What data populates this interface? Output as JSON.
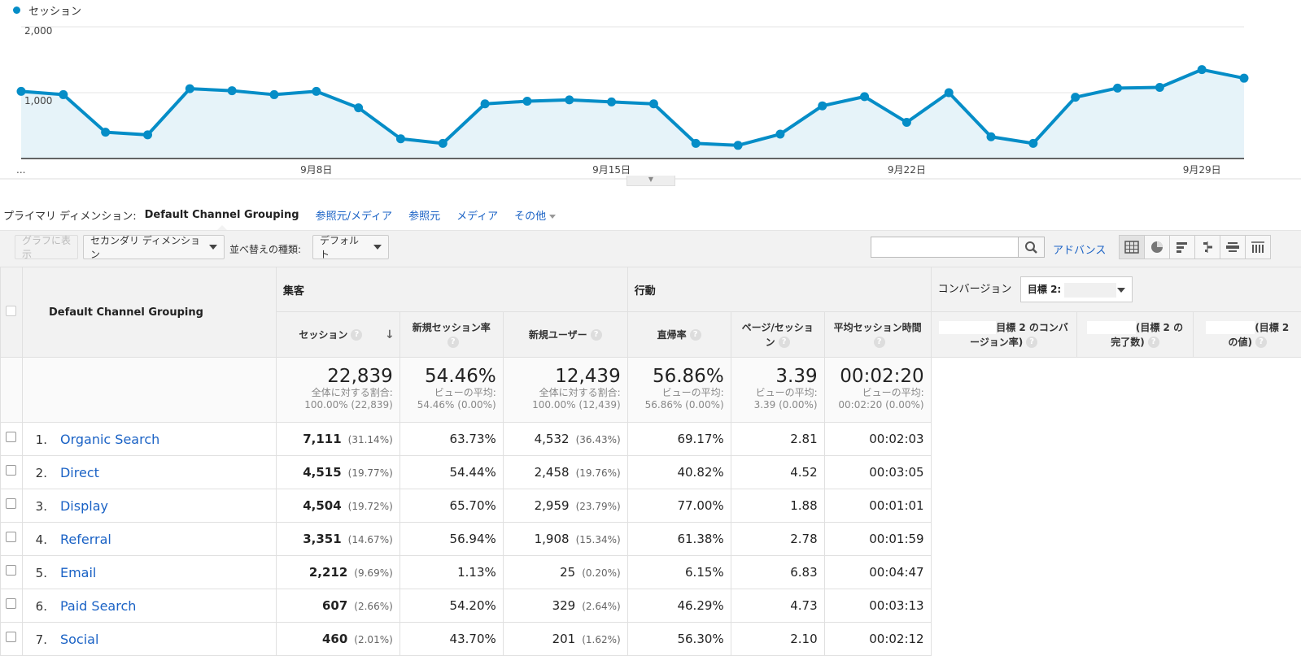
{
  "chart": {
    "legend_label": "セッション",
    "series_color": "#058dc7",
    "y_ticks": [
      "2,000",
      "1,000"
    ],
    "y_max": 2000,
    "x_labels": [
      {
        "text": "...",
        "index": 0
      },
      {
        "text": "9月8日",
        "index": 7
      },
      {
        "text": "9月15日",
        "index": 14
      },
      {
        "text": "9月22日",
        "index": 21
      },
      {
        "text": "9月29日",
        "index": 28
      }
    ]
  },
  "chart_data": {
    "type": "area",
    "title": "",
    "series": [
      {
        "name": "セッション",
        "values": [
          1020,
          970,
          400,
          360,
          1060,
          1030,
          970,
          1020,
          770,
          300,
          230,
          830,
          870,
          890,
          860,
          830,
          230,
          200,
          370,
          800,
          940,
          550,
          1000,
          330,
          230,
          930,
          1070,
          1080,
          1350,
          1220
        ]
      }
    ],
    "ylim": [
      0,
      2000
    ],
    "grid": true
  },
  "dimensions": {
    "label": "プライマリ ディメンション:",
    "active": "Default Channel Grouping",
    "links": [
      "参照元/メディア",
      "参照元",
      "メディア"
    ],
    "other": "その他"
  },
  "toolbar": {
    "plot_rows": "グラフに表示",
    "secondary_dimension": "セカンダリ ディメンション",
    "sort_label": "並べ替えの種類:",
    "sort_value": "デフォルト",
    "advanced": "アドバンス"
  },
  "table": {
    "dimension_header": "Default Channel Grouping",
    "groups": {
      "acquisition": "集客",
      "behavior": "行動",
      "conversions": "コンバージョン",
      "goal_select": "目標 2:"
    },
    "columns": {
      "sessions": "セッション",
      "new_session_rate": "新規セッション率",
      "new_users": "新規ユーザー",
      "bounce_rate": "直帰率",
      "pages_per_session_1": "ページ/セッショ",
      "pages_per_session_2": "ン",
      "avg_duration": "平均セッション時間",
      "conv_rate_1": "目標 2 のコンバ",
      "conv_rate_2": "ージョン率)",
      "completions_1": "(目標 2 の",
      "completions_2": "完了数)",
      "value_1": "(目標 2",
      "value_2": "の値)"
    },
    "totals": {
      "sessions": "22,839",
      "sessions_sub1": "全体に対する割合:",
      "sessions_sub2": "100.00% (22,839)",
      "new_session_rate": "54.46%",
      "new_session_rate_sub1": "ビューの平均:",
      "new_session_rate_sub2": "54.46% (0.00%)",
      "new_users": "12,439",
      "new_users_sub1": "全体に対する割合:",
      "new_users_sub2": "100.00% (12,439)",
      "bounce_rate": "56.86%",
      "bounce_rate_sub1": "ビューの平均:",
      "bounce_rate_sub2": "56.86% (0.00%)",
      "pps": "3.39",
      "pps_sub1": "ビューの平均:",
      "pps_sub2": "3.39 (0.00%)",
      "duration": "00:02:20",
      "duration_sub1": "ビューの平均:",
      "duration_sub2": "00:02:20 (0.00%)"
    },
    "rows": [
      {
        "rank": "1.",
        "channel": "Organic Search",
        "sessions": "7,111",
        "sessions_pct": "(31.14%)",
        "nsr": "63.73%",
        "users": "4,532",
        "users_pct": "(36.43%)",
        "bounce": "69.17%",
        "pps": "2.81",
        "dur": "00:02:03"
      },
      {
        "rank": "2.",
        "channel": "Direct",
        "sessions": "4,515",
        "sessions_pct": "(19.77%)",
        "nsr": "54.44%",
        "users": "2,458",
        "users_pct": "(19.76%)",
        "bounce": "40.82%",
        "pps": "4.52",
        "dur": "00:03:05"
      },
      {
        "rank": "3.",
        "channel": "Display",
        "sessions": "4,504",
        "sessions_pct": "(19.72%)",
        "nsr": "65.70%",
        "users": "2,959",
        "users_pct": "(23.79%)",
        "bounce": "77.00%",
        "pps": "1.88",
        "dur": "00:01:01"
      },
      {
        "rank": "4.",
        "channel": "Referral",
        "sessions": "3,351",
        "sessions_pct": "(14.67%)",
        "nsr": "56.94%",
        "users": "1,908",
        "users_pct": "(15.34%)",
        "bounce": "61.38%",
        "pps": "2.78",
        "dur": "00:01:59"
      },
      {
        "rank": "5.",
        "channel": "Email",
        "sessions": "2,212",
        "sessions_pct": "(9.69%)",
        "nsr": "1.13%",
        "users": "25",
        "users_pct": "(0.20%)",
        "bounce": "6.15%",
        "pps": "6.83",
        "dur": "00:04:47"
      },
      {
        "rank": "6.",
        "channel": "Paid Search",
        "sessions": "607",
        "sessions_pct": "(2.66%)",
        "nsr": "54.20%",
        "users": "329",
        "users_pct": "(2.64%)",
        "bounce": "46.29%",
        "pps": "4.73",
        "dur": "00:03:13"
      },
      {
        "rank": "7.",
        "channel": "Social",
        "sessions": "460",
        "sessions_pct": "(2.01%)",
        "nsr": "43.70%",
        "users": "201",
        "users_pct": "(1.62%)",
        "bounce": "56.30%",
        "pps": "2.10",
        "dur": "00:02:12"
      }
    ]
  }
}
